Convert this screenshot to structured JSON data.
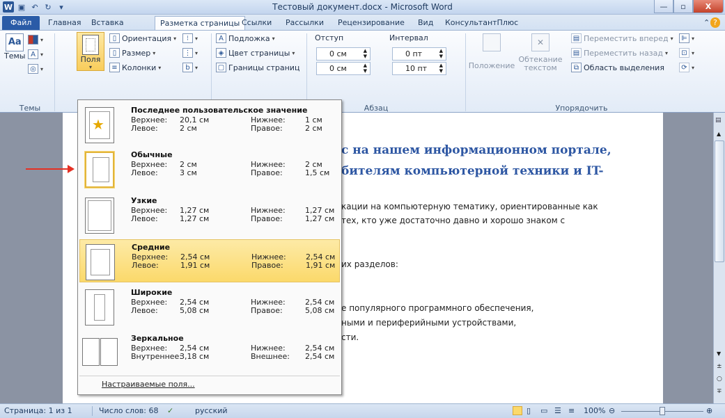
{
  "window": {
    "title": "Тестовый документ.docx - Microsoft Word"
  },
  "tabs": [
    "Файл",
    "Главная",
    "Вставка",
    "Разметка страницы",
    "Ссылки",
    "Рассылки",
    "Рецензирование",
    "Вид",
    "КонсультантПлюс"
  ],
  "ribbon": {
    "themes_label": "Темы",
    "themes_group": "Темы",
    "margins_label": "Поля",
    "orientation": "Ориентация",
    "size": "Размер",
    "columns": "Колонки",
    "watermark": "Подложка",
    "page_color": "Цвет страницы",
    "page_borders": "Границы страниц",
    "indent_label": "Отступ",
    "interval_label": "Интервал",
    "indent_left": "0 см",
    "indent_right": "0 см",
    "spacing_before": "0 пт",
    "spacing_after": "10 пт",
    "paragraph_group": "Абзац",
    "position": "Положение",
    "wrap": "Обтекание текстом",
    "bring_forward": "Переместить вперед",
    "send_backward": "Переместить назад",
    "selection_pane": "Область выделения",
    "arrange_group": "Упорядочить"
  },
  "margins_menu": {
    "items": [
      {
        "name": "Последнее пользовательское значение",
        "k1": "Верхнее:",
        "v1": "20,1 см",
        "k2": "Нижнее:",
        "v2": "1 см",
        "k3": "Левое:",
        "v3": "2 см",
        "k4": "Правое:",
        "v4": "2 см"
      },
      {
        "name": "Обычные",
        "k1": "Верхнее:",
        "v1": "2 см",
        "k2": "Нижнее:",
        "v2": "2 см",
        "k3": "Левое:",
        "v3": "3 см",
        "k4": "Правое:",
        "v4": "1,5 см"
      },
      {
        "name": "Узкие",
        "k1": "Верхнее:",
        "v1": "1,27 см",
        "k2": "Нижнее:",
        "v2": "1,27 см",
        "k3": "Левое:",
        "v3": "1,27 см",
        "k4": "Правое:",
        "v4": "1,27 см"
      },
      {
        "name": "Средние",
        "k1": "Верхнее:",
        "v1": "2,54 см",
        "k2": "Нижнее:",
        "v2": "2,54 см",
        "k3": "Левое:",
        "v3": "1,91 см",
        "k4": "Правое:",
        "v4": "1,91 см"
      },
      {
        "name": "Широкие",
        "k1": "Верхнее:",
        "v1": "2,54 см",
        "k2": "Нижнее:",
        "v2": "2,54 см",
        "k3": "Левое:",
        "v3": "5,08 см",
        "k4": "Правое:",
        "v4": "5,08 см"
      },
      {
        "name": "Зеркальное",
        "k1": "Верхнее:",
        "v1": "2,54 см",
        "k2": "Нижнее:",
        "v2": "2,54 см",
        "k3": "Внутреннее:",
        "v3": "3,18 см",
        "k4": "Внешнее:",
        "v4": "2,54 см"
      }
    ],
    "custom": "Настраиваемые поля..."
  },
  "document": {
    "heading1": "с на нашем информационном портале,",
    "heading2": "бителям компьютерной техники и IT-",
    "p1": "кации на компьютерную тематику, ориентированные как",
    "p2": "тех, кто уже достаточно давно и хорошо знаком с",
    "p3": "их разделов:",
    "p4": "е популярного программного обеспечения,",
    "p5": "ными и периферийными устройствами,",
    "p6": "сти."
  },
  "status": {
    "page": "Страница: 1 из 1",
    "words": "Число слов: 68",
    "lang": "русский",
    "zoom": "100%"
  }
}
